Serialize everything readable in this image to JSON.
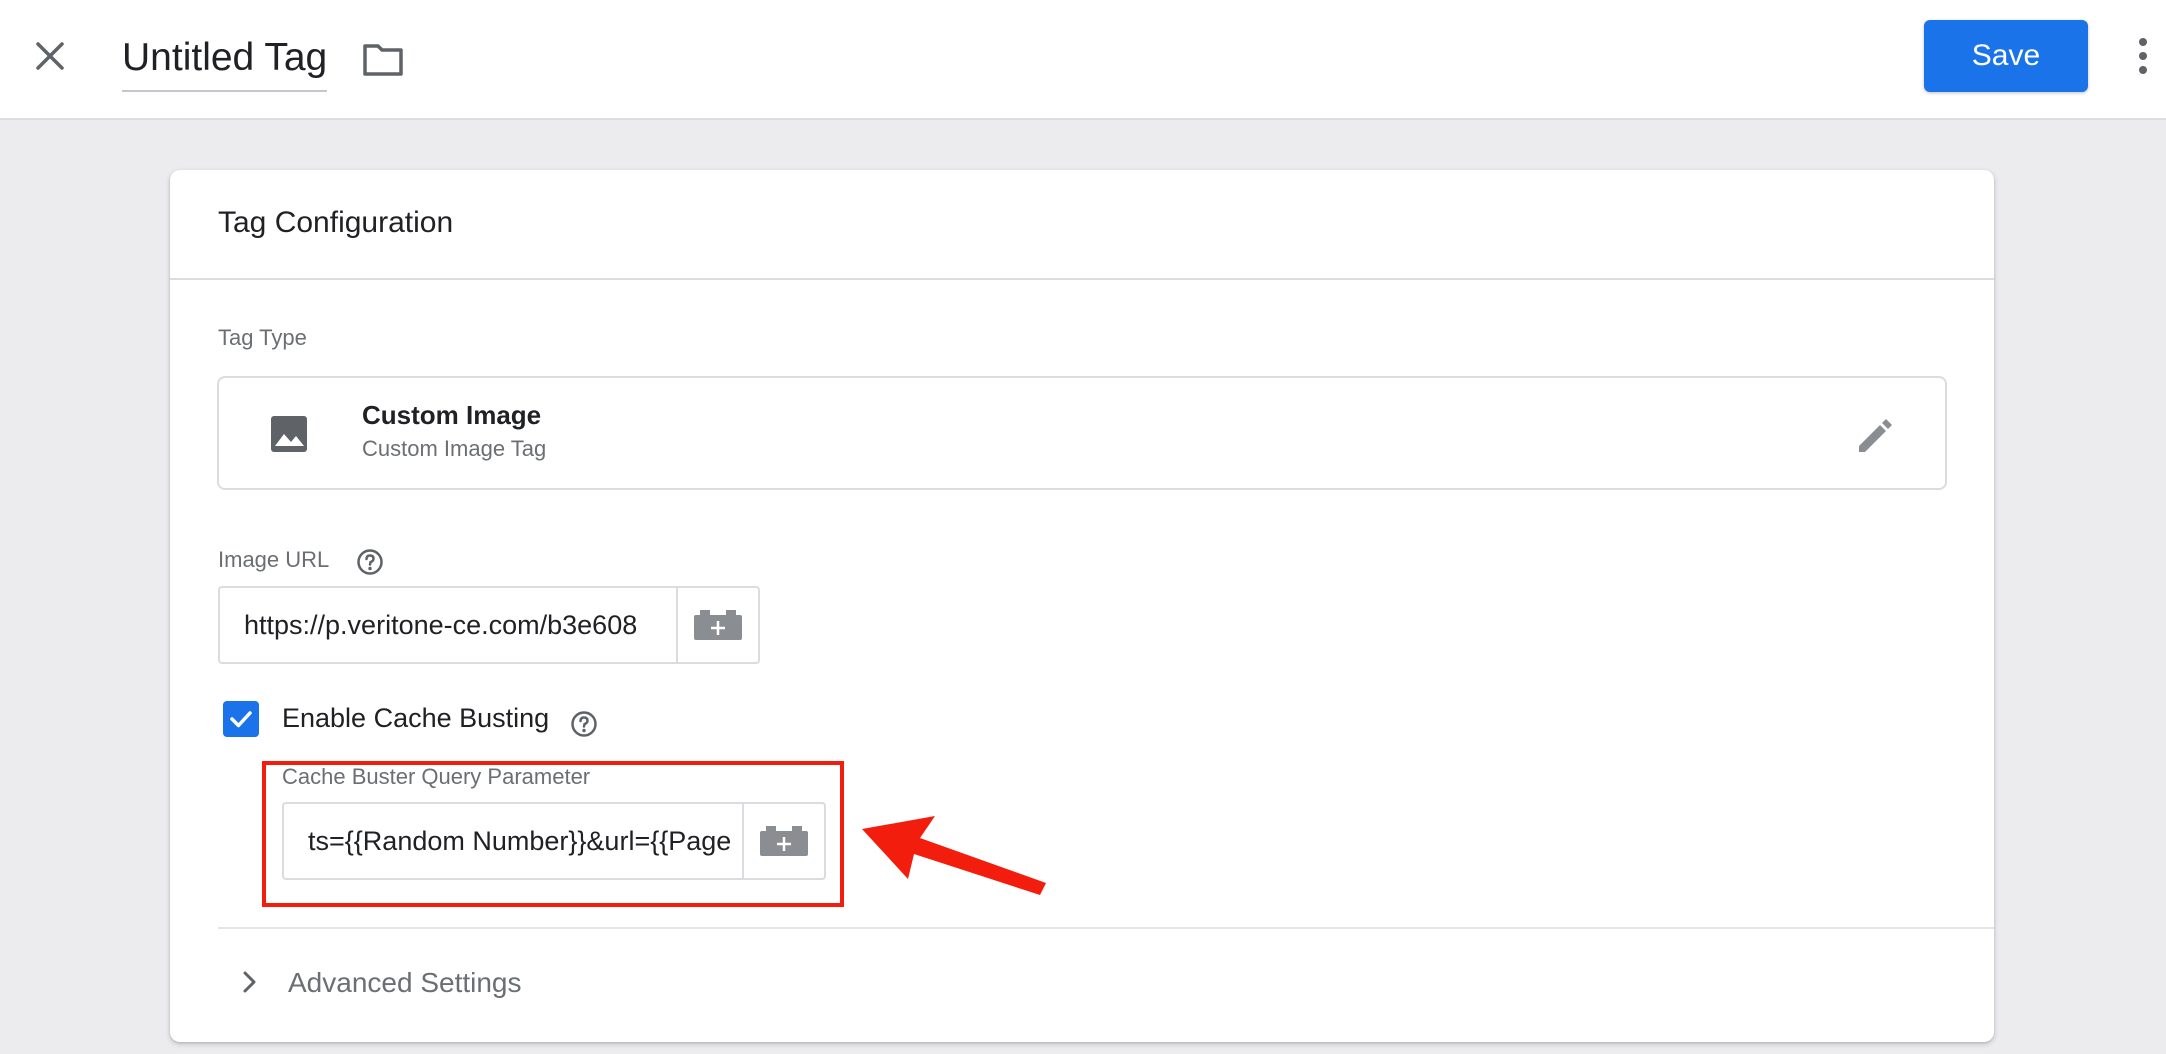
{
  "header": {
    "title": "Untitled Tag",
    "save_label": "Save",
    "close_icon": "close-icon",
    "folder_icon": "folder-icon",
    "more_icon": "more-vertical-icon"
  },
  "card": {
    "title": "Tag Configuration",
    "tag_type": {
      "label": "Tag Type",
      "name": "Custom Image",
      "subtitle": "Custom Image Tag",
      "icon": "image-icon",
      "edit_icon": "pencil-icon"
    },
    "image_url": {
      "label": "Image URL",
      "value": "https://p.veritone-ce.com/b3e608",
      "variable_icon": "variable-brick-icon"
    },
    "cache_busting": {
      "label": "Enable Cache Busting",
      "checked": true
    },
    "cache_buster": {
      "label": "Cache Buster Query Parameter",
      "value": "ts={{Random Number}}&url={{Page"
    },
    "advanced": {
      "label": "Advanced Settings"
    }
  },
  "colors": {
    "accent": "#1a73e8",
    "highlight": "#f21d0c"
  }
}
